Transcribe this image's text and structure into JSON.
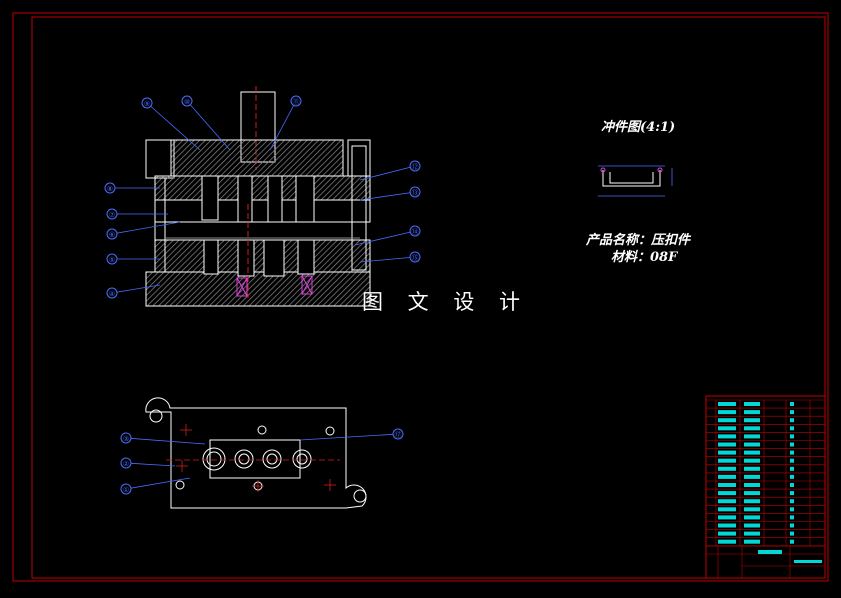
{
  "drawing": {
    "part_view_title": "冲件图(4:1)",
    "product_name_line": "产品名称：压扣件",
    "material_line": "材料：08F",
    "watermark": "图 文 设 计"
  },
  "colors": {
    "background": "#000000",
    "frame": "#c00000",
    "outline": "#ffffff",
    "callout": "#4a6cff",
    "hatch": "#8a8a8a",
    "centerline": "#d02020",
    "accent_magenta": "#e040e0",
    "table_text": "#00d8d8"
  },
  "callouts": {
    "section_view": [
      "⑨",
      "⑩",
      "⑪",
      "⑫",
      "⑬",
      "⑭",
      "⑮",
      "⑧",
      "⑦",
      "⑥",
      "⑤",
      "④"
    ],
    "plan_view": [
      "③",
      "②",
      "①",
      "⑰"
    ]
  },
  "bom_rows": 18
}
